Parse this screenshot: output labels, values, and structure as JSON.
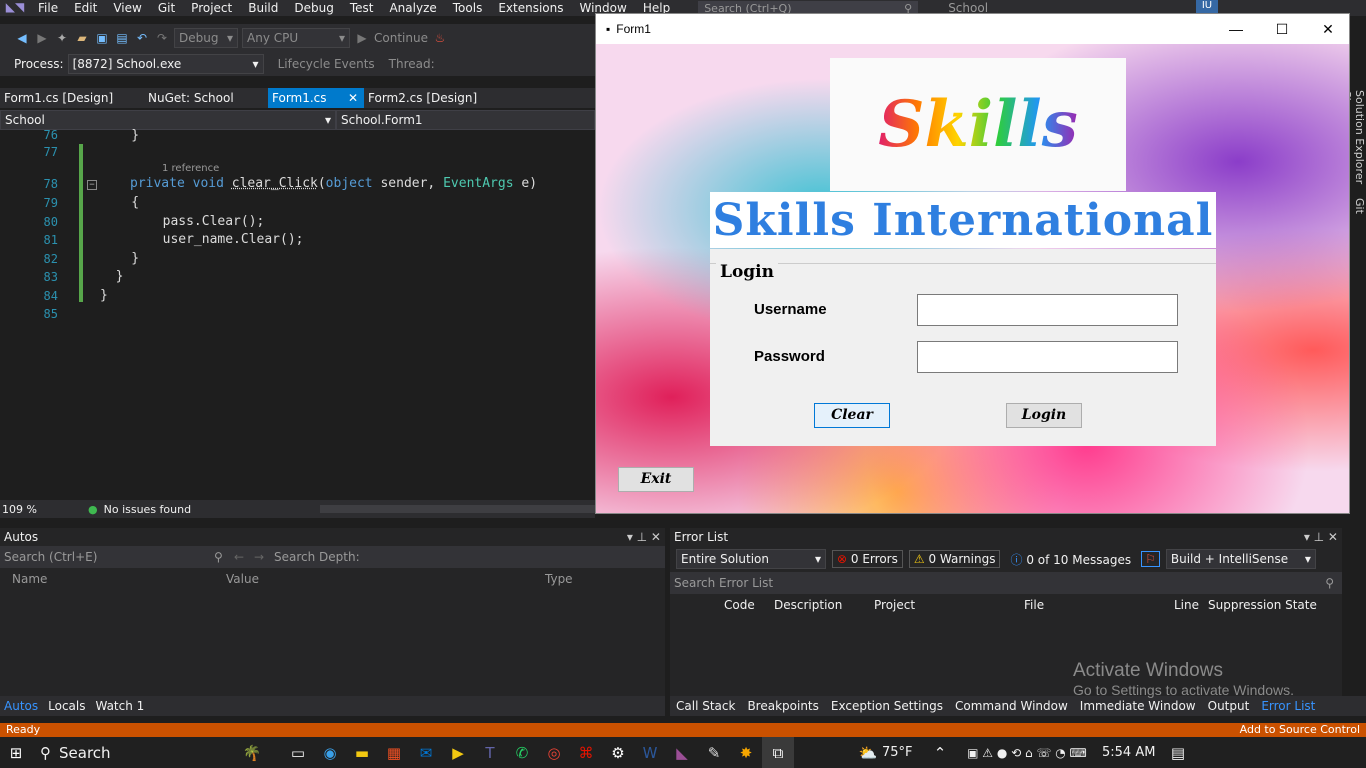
{
  "menu": {
    "items": [
      "File",
      "Edit",
      "View",
      "Git",
      "Project",
      "Build",
      "Debug",
      "Test",
      "Analyze",
      "Tools",
      "Extensions",
      "Window",
      "Help"
    ],
    "search_placeholder": "Search (Ctrl+Q)",
    "solution_name": "School",
    "avatar_initials": "IU"
  },
  "toolbar": {
    "config": "Debug",
    "platform": "Any CPU",
    "continue_label": "Continue"
  },
  "process_bar": {
    "label": "Process:",
    "value": "[8872] School.exe",
    "lifecycle": "Lifecycle Events",
    "thread_label": "Thread:"
  },
  "tabs": [
    {
      "label": "Form1.cs [Design]"
    },
    {
      "label": "NuGet: School"
    },
    {
      "label": "Form1.cs"
    },
    {
      "label": "Form2.cs [Design]"
    }
  ],
  "navbar": {
    "project": "School",
    "class": "School.Form1"
  },
  "editor": {
    "lines": [
      {
        "num": "76",
        "code": "    }"
      },
      {
        "num": "77",
        "code": ""
      },
      {
        "num": "78",
        "code": "    private void clear_Click(object sender, EventArgs e)",
        "ref": "1 reference"
      },
      {
        "num": "79",
        "code": "    {"
      },
      {
        "num": "80",
        "code": "        pass.Clear();"
      },
      {
        "num": "81",
        "code": "        user_name.Clear();"
      },
      {
        "num": "82",
        "code": "    }"
      },
      {
        "num": "83",
        "code": "  }"
      },
      {
        "num": "84",
        "code": "}"
      },
      {
        "num": "85",
        "code": ""
      }
    ]
  },
  "status_line": {
    "zoom": "109 %",
    "issues": "No issues found"
  },
  "autos": {
    "title": "Autos",
    "search_placeholder": "Search (Ctrl+E)",
    "search_depth_label": "Search Depth:",
    "columns": [
      "Name",
      "Value",
      "Type"
    ],
    "tabs": [
      "Autos",
      "Locals",
      "Watch 1"
    ]
  },
  "error_list": {
    "title": "Error List",
    "scope": "Entire Solution",
    "errors": "0 Errors",
    "warnings": "0 Warnings",
    "messages": "0 of 10 Messages",
    "build_filter": "Build + IntelliSense",
    "search_placeholder": "Search Error List",
    "columns": [
      "Code",
      "Description",
      "Project",
      "File",
      "Line",
      "Suppression State"
    ]
  },
  "bottom_right_tabs": [
    "Call Stack",
    "Breakpoints",
    "Exception Settings",
    "Command Window",
    "Immediate Window",
    "Output",
    "Error List"
  ],
  "statusbar": {
    "left": "Ready",
    "right": "Add to Source Control"
  },
  "side_tabs": [
    "Solution Explorer",
    "Git Changes"
  ],
  "activate_windows": {
    "title": "Activate Windows",
    "subtitle": "Go to Settings to activate Windows."
  },
  "form1": {
    "title": "Form1",
    "logo_text": "Skills",
    "heading": "Skills International",
    "group_label": "Login",
    "username_label": "Username",
    "password_label": "Password",
    "username_value": "",
    "password_value": "",
    "clear_button": "Clear",
    "login_button": "Login",
    "exit_button": "Exit"
  },
  "taskbar": {
    "search_label": "Search",
    "weather": "75°F",
    "time": "5:54 AM"
  },
  "colors": {
    "vs_accent": "#007acc",
    "status_orange": "#ca5100",
    "heading_blue": "#2f7fe0"
  }
}
